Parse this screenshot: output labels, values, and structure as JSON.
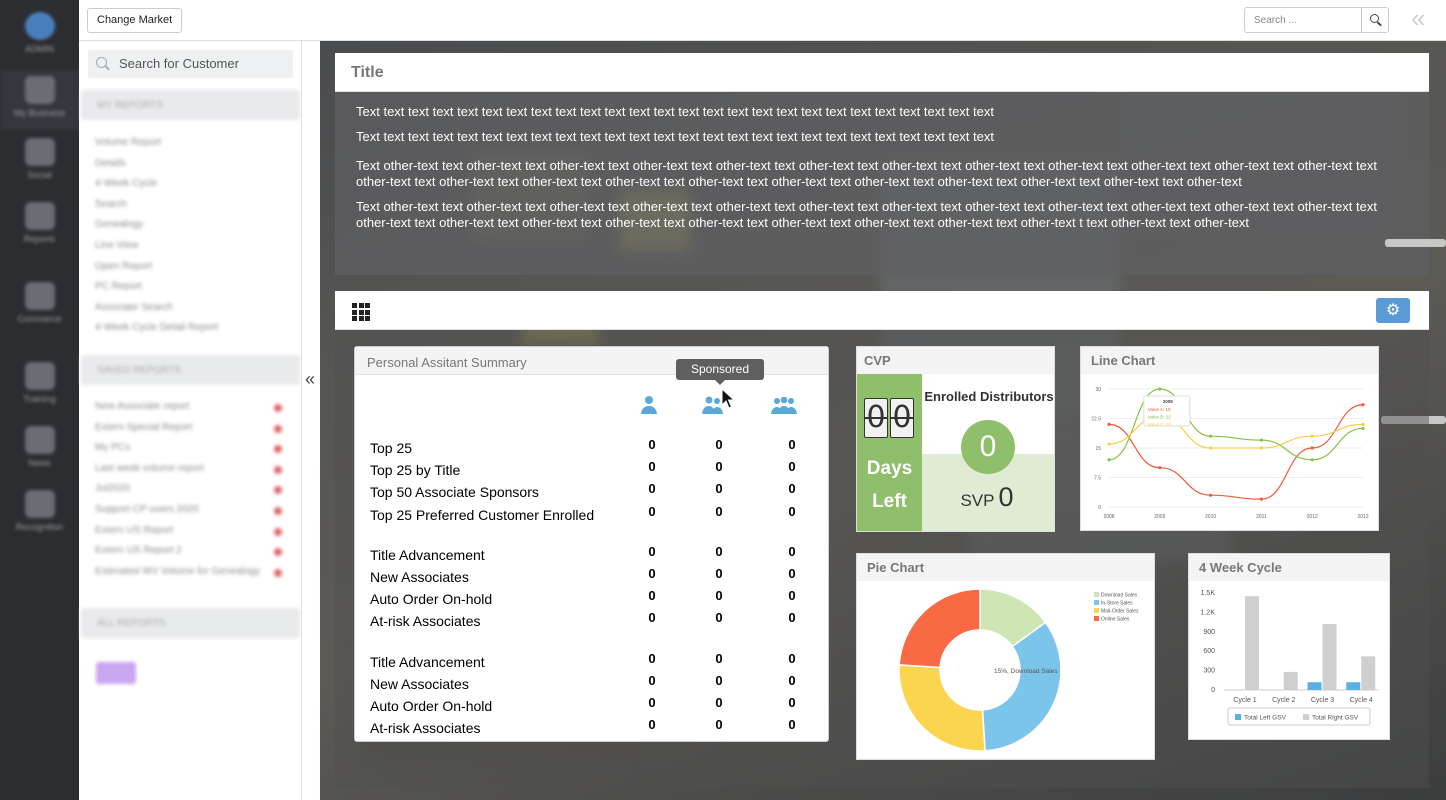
{
  "topbar": {
    "change_market_label": "Change Market",
    "search_placeholder": "Search ..."
  },
  "sidebar": {
    "search_placeholder": "Search for Customer"
  },
  "title_card": {
    "title": "Title",
    "paragraphs": [
      "Text text text text text text text text text text text text text text text text text text text text text text text text text text",
      "Text text text text text text text text text text text text text text text text text text text text text text text text text text",
      "Text other-text text other-text text other-text  text other-text  text other-text  text other-text  text other-text  text other-text  text other-text  text other-text  text other-text  text other-text  text other-text  text other-text  text other-text  text other-text  text other-text  text other-text  text other-text  text other-text  text other-text   text other-text   text other-text",
      "Text other-text text other-text text other-text  text other-text  text other-text  text other-text  text other-text  text other-text  text other-text  text other-text  text other-text  text other-text  text other-text  text other-text  text other-text  text other-text  text other-text  text other-text  text other-text  text other-text  text other-text  t  text other-text text other-text"
    ]
  },
  "summary": {
    "title": "Personal Assitant Summary",
    "tooltip": "Sponsored",
    "column_icons": [
      "person-icon",
      "sponsored-icon",
      "group-icon"
    ],
    "groups": [
      {
        "rows": [
          {
            "label": "Top 25",
            "values": [
              "0",
              "0",
              "0"
            ]
          },
          {
            "label": "Top 25 by Title",
            "values": [
              "0",
              "0",
              "0"
            ]
          },
          {
            "label": "Top 50 Associate Sponsors",
            "values": [
              "0",
              "0",
              "0"
            ]
          },
          {
            "label": "Top 25 Preferred Customer Enrolled",
            "values": [
              "0",
              "0",
              "0"
            ]
          }
        ]
      },
      {
        "rows": [
          {
            "label": "Title Advancement",
            "values": [
              "0",
              "0",
              "0"
            ]
          },
          {
            "label": "New Associates",
            "values": [
              "0",
              "0",
              "0"
            ]
          },
          {
            "label": "Auto Order On-hold",
            "values": [
              "0",
              "0",
              "0"
            ]
          },
          {
            "label": "At-risk Associates",
            "values": [
              "0",
              "0",
              "0"
            ]
          }
        ]
      },
      {
        "rows": [
          {
            "label": "Title Advancement",
            "values": [
              "0",
              "0",
              "0"
            ]
          },
          {
            "label": "New Associates",
            "values": [
              "0",
              "0",
              "0"
            ]
          },
          {
            "label": "Auto Order On-hold",
            "values": [
              "0",
              "0",
              "0"
            ]
          },
          {
            "label": "At-risk Associates",
            "values": [
              "0",
              "0",
              "0"
            ]
          }
        ]
      }
    ]
  },
  "cvp": {
    "title": "CVP",
    "digits": [
      "0",
      "0"
    ],
    "days_label_1": "Days",
    "days_label_2": "Left",
    "enrolled_label": "Enrolled Distributors",
    "enrolled_value": "0",
    "svp_label": "SVP",
    "svp_value": "0",
    "accent_color": "#8fbf6a"
  },
  "line_chart": {
    "title": "Line Chart"
  },
  "pie_chart": {
    "title": "Pie Chart"
  },
  "week_chart": {
    "title": "4 Week Cycle"
  },
  "chart_data": [
    {
      "type": "line",
      "title": "Line Chart",
      "x": [
        "2008",
        "2009",
        "2010",
        "2011",
        "2012",
        "2013"
      ],
      "ylim": [
        0,
        30
      ],
      "yticks": [
        "0",
        "7.5",
        "15",
        "22.5",
        "30"
      ],
      "tooltip": {
        "x": "2009",
        "lines": [
          "Value A: 10",
          "Value B: 22",
          "Value C: 26"
        ]
      },
      "series": [
        {
          "color": "#f15a3a",
          "values": [
            21,
            10,
            3,
            2,
            15,
            26
          ]
        },
        {
          "color": "#86c247",
          "values": [
            12,
            30,
            18,
            17,
            12,
            20
          ]
        },
        {
          "color": "#f7d04a",
          "values": [
            16,
            23,
            15,
            15,
            18,
            21
          ]
        }
      ]
    },
    {
      "type": "pie",
      "title": "Pie Chart",
      "annotation": "15%, Download Sales",
      "legend": [
        "Download Sales",
        "In-Store Sales",
        "Mail-Order Sales",
        "Online Sales"
      ],
      "legend_placement": "top-right",
      "slices": [
        {
          "value": 15,
          "color": "#cfe5b4"
        },
        {
          "value": 34,
          "color": "#7cc5ea"
        },
        {
          "value": 27,
          "color": "#fbd550"
        },
        {
          "value": 24,
          "color": "#f86a43"
        }
      ]
    },
    {
      "type": "bar",
      "title": "4 Week Cycle",
      "categories": [
        "Cycle 1",
        "Cycle 2",
        "Cycle 3",
        "Cycle 4"
      ],
      "ylim": [
        0,
        1500
      ],
      "yticks": [
        "0",
        "300",
        "600",
        "900",
        "1.2K",
        "1.5K"
      ],
      "series": [
        {
          "name": "Total Left GSV",
          "color": "#5ab0e3",
          "values": [
            0,
            0,
            120,
            120
          ]
        },
        {
          "name": "Total Right GSV",
          "color": "#cfcfcf",
          "values": [
            1450,
            280,
            1020,
            520
          ]
        }
      ],
      "legend_placement": "bottom"
    }
  ]
}
